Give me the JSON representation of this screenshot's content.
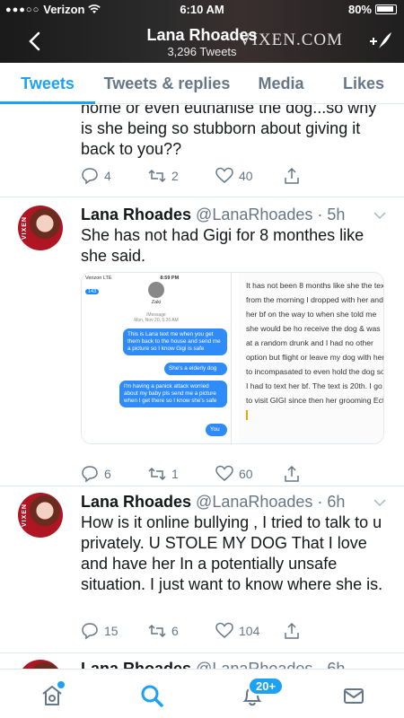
{
  "status": {
    "carrier": "Verizon",
    "signal": "●●●○○",
    "time": "6:10 AM",
    "battery": "80%"
  },
  "header": {
    "title": "Lana Rhoades",
    "subtitle": "3,296 Tweets",
    "watermark": "VIXEN.COM"
  },
  "tabs": [
    {
      "label": "Tweets",
      "active": true
    },
    {
      "label": "Tweets & replies",
      "active": false
    },
    {
      "label": "Media",
      "active": false
    },
    {
      "label": "Likes",
      "active": false
    }
  ],
  "partial_tweet": {
    "text": "home or even euthanise the dog...so why is she being so stubborn about giving it back to you??",
    "replies": "4",
    "retweets": "2",
    "likes": "40"
  },
  "tweets": [
    {
      "name": "Lana Rhoades",
      "handle": "@LanaRhoades",
      "time": "5h",
      "text": "She has not had Gigi for 8 monthes like she said.",
      "replies": "6",
      "retweets": "1",
      "likes": "60",
      "media": {
        "phone": {
          "carrier": "Verizon  LTE",
          "time": "8:59 PM",
          "back_count": "143",
          "contact": "Zaki",
          "imessage": "iMessage",
          "stamp": "Mon, Nov 20, 5:26 AM",
          "bubbles": [
            "This is Lana text me when you get them back to the house and send me a picture so I know Gigi is safe",
            "She's a elderly dog",
            "I'm having a panick attack worried about my baby pls send me a picture when I get there so I know she's safe",
            "You"
          ]
        },
        "notes": "It has not been 8 months like she the text from the morning I dropped with her and her bf on the way to when she told me she would be ho receive the dog & was at a random drunk and I had no other option but flight or leave my dog with her to incompasated to even hold the dog so I had to text her bf. The text is 20th. I go to visit GIGI since then her grooming Ect."
      }
    },
    {
      "name": "Lana Rhoades",
      "handle": "@LanaRhoades",
      "time": "6h",
      "text": "How is it online bullying , I tried to talk to u privately. U STOLE MY DOG That I love and have her In a potentially unsafe situation. I just want to know where she is.",
      "replies": "15",
      "retweets": "6",
      "likes": "104"
    },
    {
      "name": "Lana Rhoades",
      "handle": "@LanaRhoades",
      "time": "6h"
    }
  ],
  "nav": {
    "notif_badge": "20+"
  },
  "avatar_text": "VIXEN",
  "colors": {
    "accent": "#1da1f2",
    "muted": "#657786"
  }
}
